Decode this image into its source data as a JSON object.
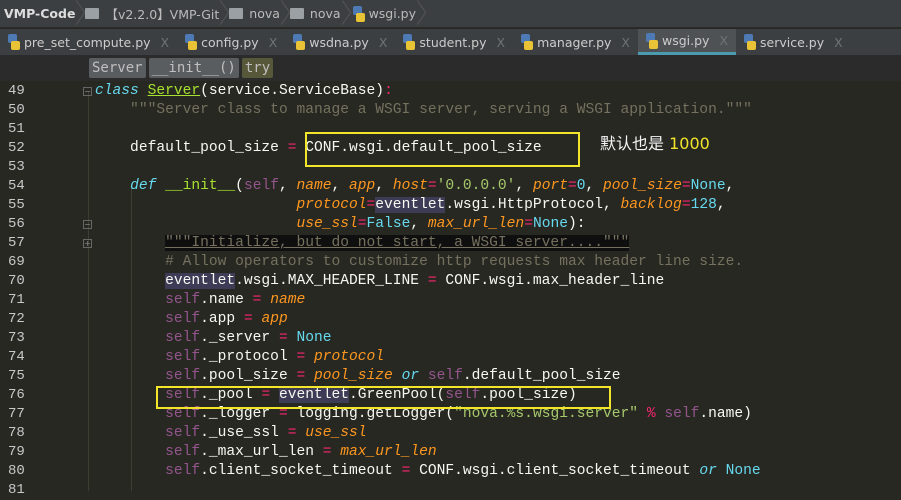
{
  "breadcrumb": [
    "VMP-Code",
    "【v2.2.0】VMP-Git",
    "nova",
    "nova",
    "wsgi.py"
  ],
  "tabs": [
    {
      "label": "pre_set_compute.py"
    },
    {
      "label": "config.py"
    },
    {
      "label": "wsdna.py"
    },
    {
      "label": "student.py"
    },
    {
      "label": "manager.py"
    },
    {
      "label": "wsgi.py",
      "active": true
    },
    {
      "label": "service.py"
    }
  ],
  "tab_close": "X",
  "scope": [
    "Server",
    "__init__()",
    "try"
  ],
  "annotation": {
    "text": "默认也是 ",
    "number": "1000"
  },
  "colors": {
    "highlight_box": "#f2e52a",
    "active_tab_underline": "#4a9bb0"
  },
  "lines": [
    {
      "n": "49",
      "t": [
        [
          "    ",
          ""
        ],
        [
          "class",
          "kw"
        ],
        [
          " ",
          ""
        ],
        [
          "Server",
          "cls"
        ],
        [
          "(service.ServiceBase)",
          ""
        ],
        [
          ":",
          "op"
        ]
      ]
    },
    {
      "n": "50",
      "t": [
        [
          "        \"\"\"Server class to manage a WSGI server, serving a WSGI application.\"\"\"",
          "doc"
        ]
      ]
    },
    {
      "n": "51",
      "t": []
    },
    {
      "n": "52",
      "t": [
        [
          "        default_pool_size ",
          ""
        ],
        [
          "=",
          "op"
        ],
        [
          " ",
          ""
        ],
        [
          "CONF.wsgi.default_pool_size",
          ""
        ]
      ]
    },
    {
      "n": "53",
      "t": []
    },
    {
      "n": "54",
      "t": [
        [
          "        ",
          ""
        ],
        [
          "def",
          "kw"
        ],
        [
          " ",
          ""
        ],
        [
          "__init__",
          "fn"
        ],
        [
          "(",
          ""
        ],
        [
          "self",
          "self"
        ],
        [
          ", ",
          ""
        ],
        [
          "name",
          "param"
        ],
        [
          ", ",
          ""
        ],
        [
          "app",
          "param"
        ],
        [
          ", ",
          ""
        ],
        [
          "host",
          "param"
        ],
        [
          "=",
          "op"
        ],
        [
          "'0.0.0.0'",
          "str"
        ],
        [
          ", ",
          ""
        ],
        [
          "port",
          "param"
        ],
        [
          "=",
          "op"
        ],
        [
          "0",
          "num"
        ],
        [
          ", ",
          ""
        ],
        [
          "pool_size",
          "param"
        ],
        [
          "=",
          "op"
        ],
        [
          "None",
          "const"
        ],
        [
          ",",
          ""
        ]
      ]
    },
    {
      "n": "55",
      "t": [
        [
          "                           ",
          ""
        ],
        [
          "protocol",
          "param"
        ],
        [
          "=",
          "op"
        ],
        [
          "eventlet",
          "hl"
        ],
        [
          ".wsgi.HttpProtocol, ",
          ""
        ],
        [
          "backlog",
          "param"
        ],
        [
          "=",
          "op"
        ],
        [
          "128",
          "num"
        ],
        [
          ",",
          ""
        ]
      ]
    },
    {
      "n": "56",
      "t": [
        [
          "                           ",
          ""
        ],
        [
          "use_ssl",
          "param"
        ],
        [
          "=",
          "op"
        ],
        [
          "False",
          "const"
        ],
        [
          ", ",
          ""
        ],
        [
          "max_url_len",
          "param"
        ],
        [
          "=",
          "op"
        ],
        [
          "None",
          "const"
        ],
        [
          "):",
          ""
        ]
      ]
    },
    {
      "n": "57",
      "t": [
        [
          "            ",
          ""
        ],
        [
          "\"\"\"Initialize, but do not start, a WSGI server....\"\"\"",
          "docbox"
        ]
      ]
    },
    {
      "n": "69",
      "t": [
        [
          "            # Allow operators to customize http requests max header line size.",
          "cm"
        ]
      ]
    },
    {
      "n": "70",
      "t": [
        [
          "            ",
          ""
        ],
        [
          "eventlet",
          "hl"
        ],
        [
          ".wsgi.MAX_HEADER_LINE ",
          ""
        ],
        [
          "=",
          "op"
        ],
        [
          " CONF.wsgi.max_header_line",
          ""
        ]
      ]
    },
    {
      "n": "71",
      "t": [
        [
          "            ",
          ""
        ],
        [
          "self",
          "self"
        ],
        [
          ".name ",
          ""
        ],
        [
          "=",
          "op"
        ],
        [
          " ",
          ""
        ],
        [
          "name",
          "param"
        ]
      ]
    },
    {
      "n": "72",
      "t": [
        [
          "            ",
          ""
        ],
        [
          "self",
          "self"
        ],
        [
          ".app ",
          ""
        ],
        [
          "=",
          "op"
        ],
        [
          " ",
          ""
        ],
        [
          "app",
          "param"
        ]
      ]
    },
    {
      "n": "73",
      "t": [
        [
          "            ",
          ""
        ],
        [
          "self",
          "self"
        ],
        [
          "._server ",
          ""
        ],
        [
          "=",
          "op"
        ],
        [
          " ",
          ""
        ],
        [
          "None",
          "const"
        ]
      ]
    },
    {
      "n": "74",
      "t": [
        [
          "            ",
          ""
        ],
        [
          "self",
          "self"
        ],
        [
          "._protocol ",
          ""
        ],
        [
          "=",
          "op"
        ],
        [
          " ",
          ""
        ],
        [
          "protocol",
          "param"
        ]
      ]
    },
    {
      "n": "75",
      "t": [
        [
          "            ",
          ""
        ],
        [
          "self",
          "self"
        ],
        [
          ".pool_size ",
          ""
        ],
        [
          "=",
          "op"
        ],
        [
          " ",
          ""
        ],
        [
          "pool_size",
          "param"
        ],
        [
          " ",
          ""
        ],
        [
          "or",
          "kw"
        ],
        [
          " ",
          ""
        ],
        [
          "self",
          "self"
        ],
        [
          ".default_pool_size",
          ""
        ]
      ]
    },
    {
      "n": "76",
      "t": [
        [
          "            ",
          ""
        ],
        [
          "self",
          "self"
        ],
        [
          "._pool ",
          ""
        ],
        [
          "=",
          "op"
        ],
        [
          " ",
          ""
        ],
        [
          "eventlet",
          "hl"
        ],
        [
          ".GreenPool(",
          ""
        ],
        [
          "self",
          "self"
        ],
        [
          ".pool_size)",
          ""
        ]
      ]
    },
    {
      "n": "77",
      "t": [
        [
          "            ",
          ""
        ],
        [
          "self",
          "self"
        ],
        [
          "._logger ",
          ""
        ],
        [
          "=",
          "op"
        ],
        [
          " logging.getLogger(",
          ""
        ],
        [
          "\"nova.%s.wsgi.server\"",
          "str"
        ],
        [
          " ",
          ""
        ],
        [
          "%",
          "op"
        ],
        [
          " ",
          ""
        ],
        [
          "self",
          "self"
        ],
        [
          ".name)",
          ""
        ]
      ]
    },
    {
      "n": "78",
      "t": [
        [
          "            ",
          ""
        ],
        [
          "self",
          "self"
        ],
        [
          "._use_ssl ",
          ""
        ],
        [
          "=",
          "op"
        ],
        [
          " ",
          ""
        ],
        [
          "use_ssl",
          "param"
        ]
      ]
    },
    {
      "n": "79",
      "t": [
        [
          "            ",
          ""
        ],
        [
          "self",
          "self"
        ],
        [
          "._max_url_len ",
          ""
        ],
        [
          "=",
          "op"
        ],
        [
          " ",
          ""
        ],
        [
          "max_url_len",
          "param"
        ]
      ]
    },
    {
      "n": "80",
      "t": [
        [
          "            ",
          ""
        ],
        [
          "self",
          "self"
        ],
        [
          ".client_socket_timeout ",
          ""
        ],
        [
          "=",
          "op"
        ],
        [
          " CONF.wsgi.client_socket_timeout ",
          ""
        ],
        [
          "or",
          "kw"
        ],
        [
          " ",
          ""
        ],
        [
          "None",
          "const"
        ]
      ]
    },
    {
      "n": "81",
      "t": []
    }
  ]
}
